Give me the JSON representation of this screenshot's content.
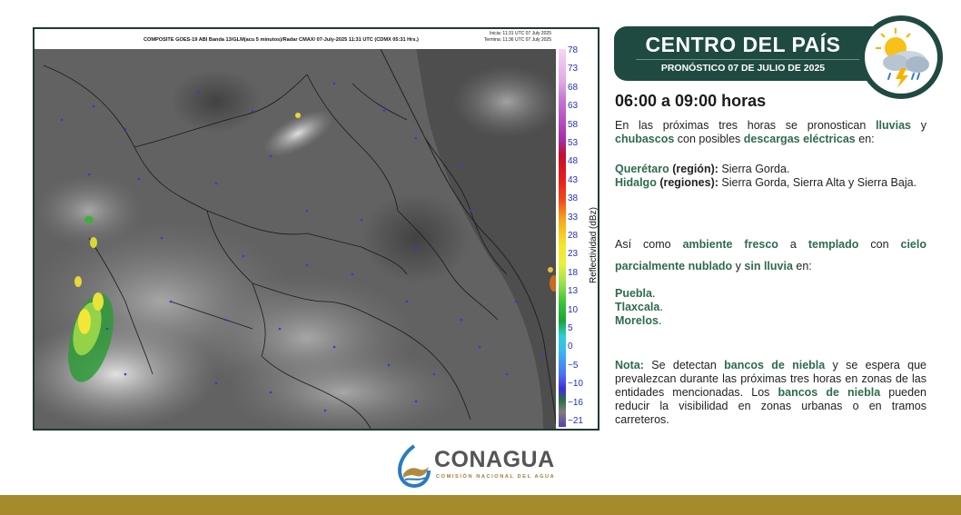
{
  "map": {
    "header_title": "COMPOSITE GOES-19 ABI Banda 13/GLM(acu 5 minutos)/Radar CMAX/ 07-July-2025 11:31 UTC  (CDMX  05:31 Hrs.)",
    "start_time": "Inicia: 11:31 UTC 07 July 2025",
    "end_time": "Termina: 11:36 UTC 07 July 2025",
    "scale_label": "Reflectividad (dBz)",
    "scale_ticks": [
      "78",
      "73",
      "68",
      "63",
      "58",
      "53",
      "48",
      "43",
      "38",
      "33",
      "28",
      "23",
      "18",
      "13",
      "10",
      "5",
      "0",
      "−5",
      "−10",
      "−16",
      "−21"
    ]
  },
  "banner": {
    "title": "CENTRO DEL PAÍS",
    "subtitle": "PRONÓSTICO 07 DE JULIO DE 2025",
    "weather_icon": "sun-cloud-storm-icon"
  },
  "forecast": {
    "time_range": "06:00 a 09:00 horas",
    "intro": {
      "t1": "En las próximas tres horas se pronostican ",
      "h1": "lluvias",
      "t2": " y ",
      "h2": "chubascos",
      "t3": " con posibles ",
      "h3": "descargas eléctricas",
      "t4": " en:"
    },
    "regions": {
      "qro_state": "Querétaro",
      "qro_kind": " (región):",
      "qro_places": " Sierra Gorda.",
      "hgo_state": "Hidalgo",
      "hgo_kind": " (regiones):",
      "hgo_places": " Sierra Gorda, Sierra Alta y Sierra Baja."
    },
    "second": {
      "t1": "Así como ",
      "h1": "ambiente fresco",
      "t2": " a ",
      "h2": "templado",
      "t3": " con ",
      "h3": "cielo parcialmente nublado",
      "t4": " y ",
      "h4": "sin lluvia",
      "t5": " en:"
    },
    "states": [
      "Puebla",
      "Tlaxcala",
      "Morelos"
    ],
    "note": {
      "label": "Nota:",
      "t1": " Se detectan ",
      "h1": "bancos de niebla",
      "t2": " y se espera que prevalezcan durante las próximas tres horas en zonas de las entidades mencionadas. Los ",
      "h2": "bancos de niebla",
      "t3": " pueden reducir la visibilidad en zonas urbanas o en tramos carreteros."
    }
  },
  "footer": {
    "logo_name": "CONAGUA",
    "logo_subtitle": "COMISIÓN NACIONAL DEL AGUA",
    "logo_icon": "conagua-logo-icon",
    "bar_color": "#a68a2b"
  },
  "colors": {
    "banner_green": "#1f4a41",
    "highlight_green": "#2e6b4c"
  }
}
